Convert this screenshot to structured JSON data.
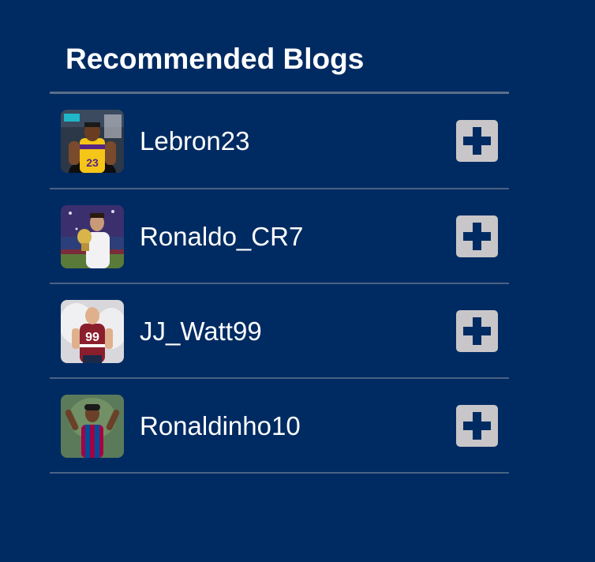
{
  "section": {
    "title": "Recommended Blogs"
  },
  "blogs": [
    {
      "name": "Lebron23",
      "avatar": "lebron-photo",
      "action_icon": "plus-icon",
      "accent": "#f5c518"
    },
    {
      "name": "Ronaldo_CR7",
      "avatar": "ronaldo-photo",
      "action_icon": "plus-icon",
      "accent": "#e8e8ee"
    },
    {
      "name": "JJ_Watt99",
      "avatar": "jj-watt-photo",
      "action_icon": "plus-icon",
      "accent": "#8b1e2c"
    },
    {
      "name": "Ronaldinho10",
      "avatar": "ronaldinho-photo",
      "action_icon": "plus-icon",
      "accent": "#a50044"
    }
  ],
  "colors": {
    "background": "#002b62",
    "add_button": "#c8c6c8",
    "plus_glyph": "#002b62",
    "divider": "#4a6284"
  }
}
